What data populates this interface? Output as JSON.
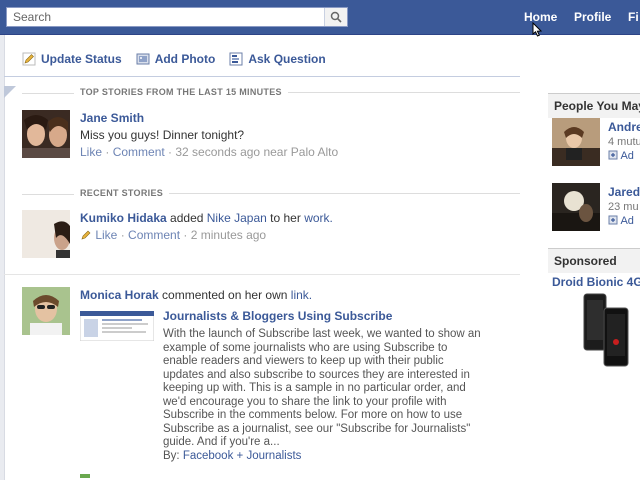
{
  "header": {
    "search_placeholder": "Search",
    "nav": [
      "Home",
      "Profile",
      "Fi"
    ]
  },
  "composer": {
    "actions": [
      "Update Status",
      "Add Photo",
      "Ask Question"
    ]
  },
  "feed": {
    "top_stories_header": "TOP STORIES FROM THE LAST 15 MINUTES",
    "recent_stories_header": "RECENT STORIES",
    "story1": {
      "name": "Jane Smith",
      "message": "Miss you guys! Dinner tonight?",
      "like": "Like",
      "comment": "Comment",
      "time": "32 seconds ago near Palo Alto"
    },
    "story2": {
      "name": "Kumiko Hidaka",
      "added": "added",
      "page": "Nike Japan",
      "to_her": "to her",
      "work": "work.",
      "like": "Like",
      "comment": "Comment",
      "time": "2 minutes ago"
    },
    "story3": {
      "name": "Monica Horak",
      "action": "commented on her own",
      "link": "link.",
      "attachment_title": "Journalists & Bloggers Using Subscribe",
      "attachment_lines": [
        "With the launch of Subscribe last week, we wanted to show an",
        "example of some journalists who are using Subscribe to",
        "enable readers and viewers to keep up with their public",
        "updates and also subscribe to sources they are interested in",
        "keeping up with.  This is a sample in no particular order, and",
        "we'd encourage you to share the link to your profile with",
        "Subscribe in the comments below. For more on how to use",
        "Subscribe as a journalist, see our \"Subscribe for Journalists\"",
        "guide. And if you're a..."
      ],
      "by_label": "By:",
      "by_source": "Facebook + Journalists"
    }
  },
  "sidebar": {
    "people_header": "People You May",
    "people": [
      {
        "name": "Andre",
        "mutual": "4 mutu",
        "add": "Ad"
      },
      {
        "name": "Jared",
        "mutual": "23 mu",
        "add": "Ad"
      }
    ],
    "sponsored_header": "Sponsored",
    "ad_title": "Droid Bionic 4G"
  },
  "colors": {
    "brand_blue": "#3b5998",
    "link_blue": "#3b5998",
    "meta_grey": "#999999"
  }
}
